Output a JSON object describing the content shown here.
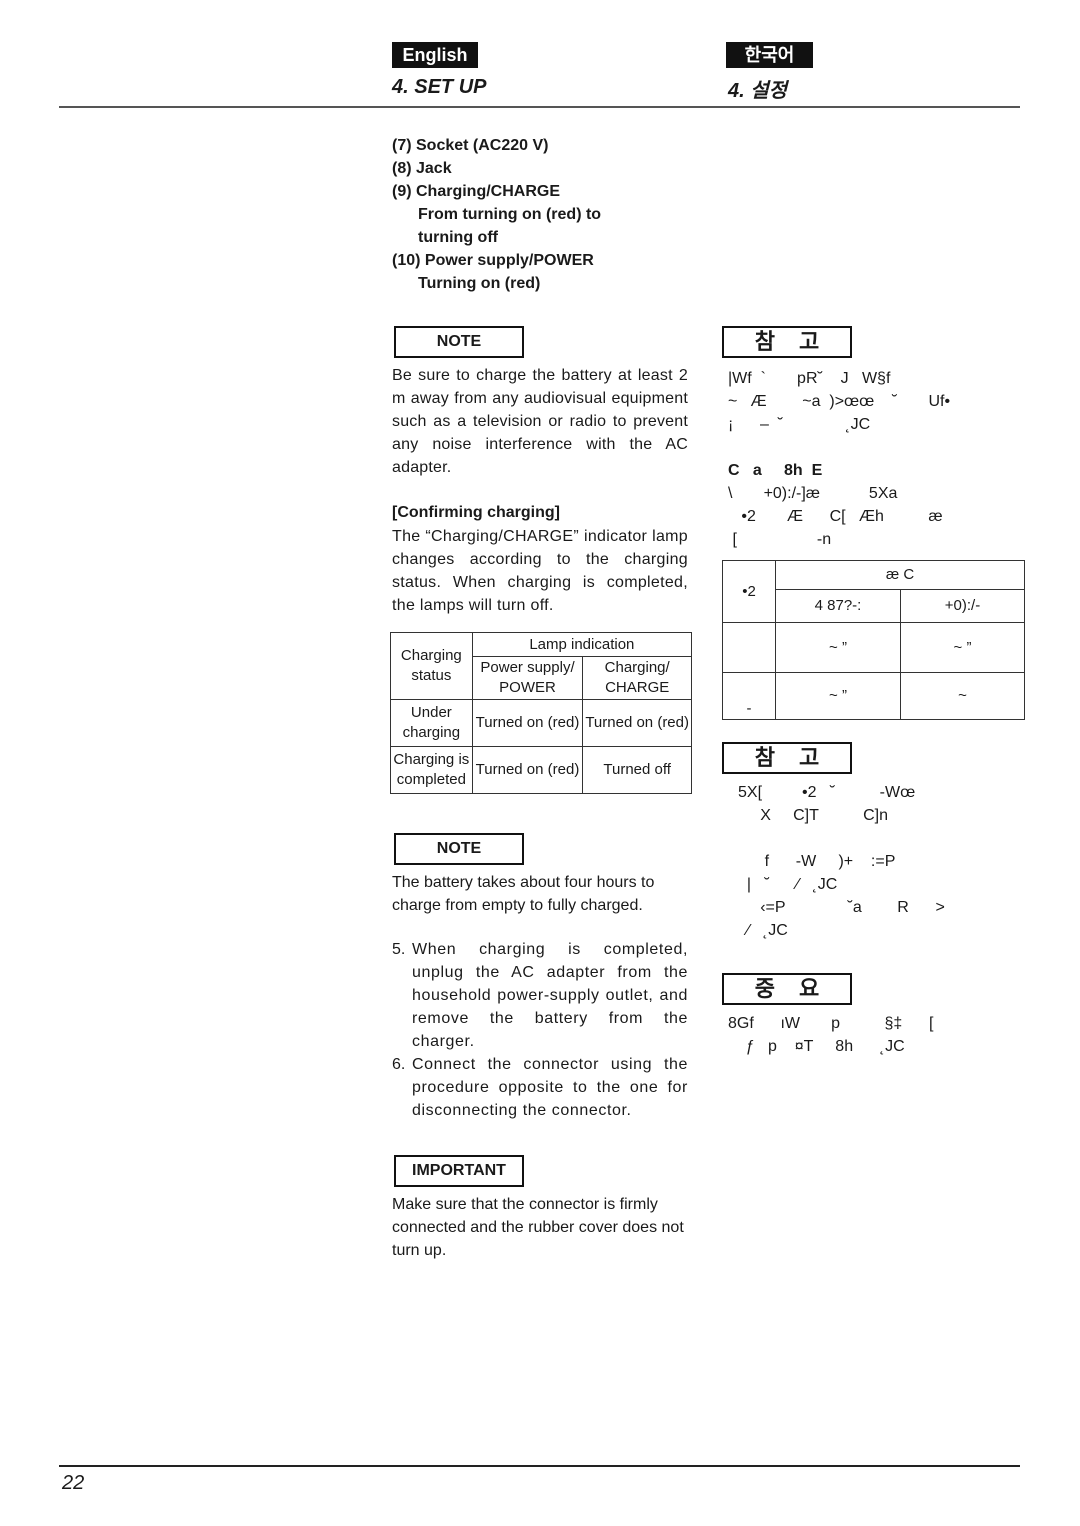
{
  "header": {
    "lang_en": "English",
    "lang_kr": "한국어",
    "title_en": "4. SET UP",
    "title_kr": "4. 설정"
  },
  "english": {
    "parts_list": [
      {
        "num": "(7) ",
        "lines": [
          "Socket (AC220 V)"
        ]
      },
      {
        "num": "(8) ",
        "lines": [
          "Jack"
        ]
      },
      {
        "num": "(9) ",
        "lines": [
          "Charging/CHARGE",
          "From turning on (red) to",
          "turning off"
        ]
      },
      {
        "num": "(10) ",
        "lines": [
          "Power supply/POWER",
          "Turning on (red)"
        ]
      }
    ],
    "note1_label": "NOTE",
    "note1_text": "Be sure to charge the battery at least 2 m away from any audiovisual equipment such as a television or radio to prevent any noise interference with the AC adapter.",
    "confirm_heading": "[Confirming charging]",
    "confirm_text": "The “Charging/CHARGE” indicator lamp changes according to the charging status. When charging is completed, the lamps will turn off.",
    "table": {
      "col_status": "Charging status",
      "col_group": "Lamp indication",
      "col_power": "Power supply/ POWER",
      "col_charge": "Charging/ CHARGE",
      "rows": [
        {
          "status": "Under charging",
          "power": "Turned on (red)",
          "charge": "Turned on (red)"
        },
        {
          "status": "Charging is completed",
          "power": "Turned on (red)",
          "charge": "Turned off"
        }
      ]
    },
    "note2_label": "NOTE",
    "note2_text": "The battery takes about four hours to charge from empty to fully charged.",
    "steps": [
      {
        "num": "5.",
        "text": "When charging is completed, unplug the AC adapter from the household power-supply outlet, and remove the battery from the charger."
      },
      {
        "num": "6.",
        "text": "Connect the connector using the procedure opposite to the one for disconnecting the connector."
      }
    ],
    "important_label": "IMPORTANT",
    "important_text": "Make sure that the connector is firmly connected and the rubber cover does not turn up."
  },
  "korean": {
    "note1_label": "참고",
    "note1_lines": [
      "|Wf  `       pR˘    J   W§f",
      "~   Æ        ~a  )>œœ    ˘       Uf•",
      "¡      –  ˘              ˛JC"
    ],
    "confirm_heading": "C   a     8h  E",
    "confirm_lines": [
      "\\       +0):/-]æ           5Xa",
      "   •2       Æ      C[   Æh          æ",
      " [                  -n"
    ],
    "table": {
      "col_status": "•2",
      "col_group": "æ     C",
      "col_power": "4  87?-:",
      "col_charge": "+0):/-",
      "rows": [
        {
          "status": "",
          "power": "~      ”",
          "charge": "~      ”"
        },
        {
          "status": "-",
          "power": "~      ”",
          "charge": "~"
        }
      ]
    },
    "note2_label": "참고",
    "note2_lines": [
      "5X[         •2   ˘          -Wœ",
      "     X     C]T          C]n",
      "",
      "      f      -W     )+    :=P",
      "  |   ˘      ⁄   ˛JC",
      "     ‹=P              ˘a        R      >",
      "  ⁄   ˛JC"
    ],
    "important_label": "중요",
    "important_lines": [
      "8Gf      ıW       p          §‡      [",
      "    ƒ   p    ¤T     8h      ˛JC"
    ]
  },
  "footer": {
    "page_number": "22"
  }
}
